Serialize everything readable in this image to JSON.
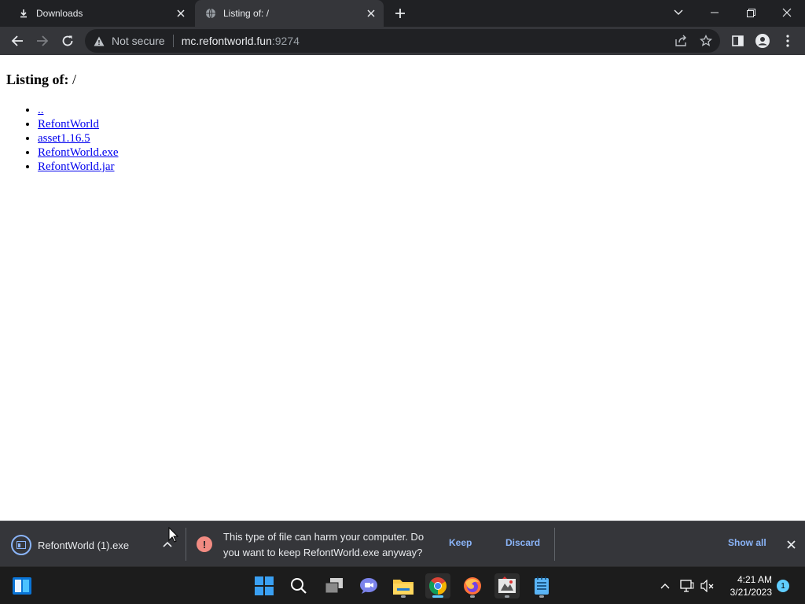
{
  "browser": {
    "tabs": [
      {
        "label": "Downloads",
        "icon": "download-icon"
      },
      {
        "label": "Listing of: /",
        "icon": "globe-icon"
      }
    ],
    "omnibox": {
      "security_label": "Not secure",
      "host": "mc.refontworld.fun",
      "port": ":9274"
    }
  },
  "page": {
    "heading_label": "Listing of:",
    "heading_path": "/",
    "items": [
      "..",
      "RefontWorld",
      "asset1.16.5",
      "RefontWorld.exe",
      "RefontWorld.jar"
    ]
  },
  "download_bar": {
    "filename": "RefontWorld (1).exe",
    "warning": "This type of file can harm your computer. Do you want to keep RefontWorld.exe anyway?",
    "keep_label": "Keep",
    "discard_label": "Discard",
    "show_all_label": "Show all"
  },
  "taskbar": {
    "time": "4:21 AM",
    "date": "3/21/2023",
    "notification_count": "1"
  },
  "colors": {
    "chrome_dark": "#202124",
    "toolbar": "#35363a",
    "link": "#0000ee",
    "accent_blue": "#8ab4f8",
    "warning_red": "#f28b82"
  }
}
